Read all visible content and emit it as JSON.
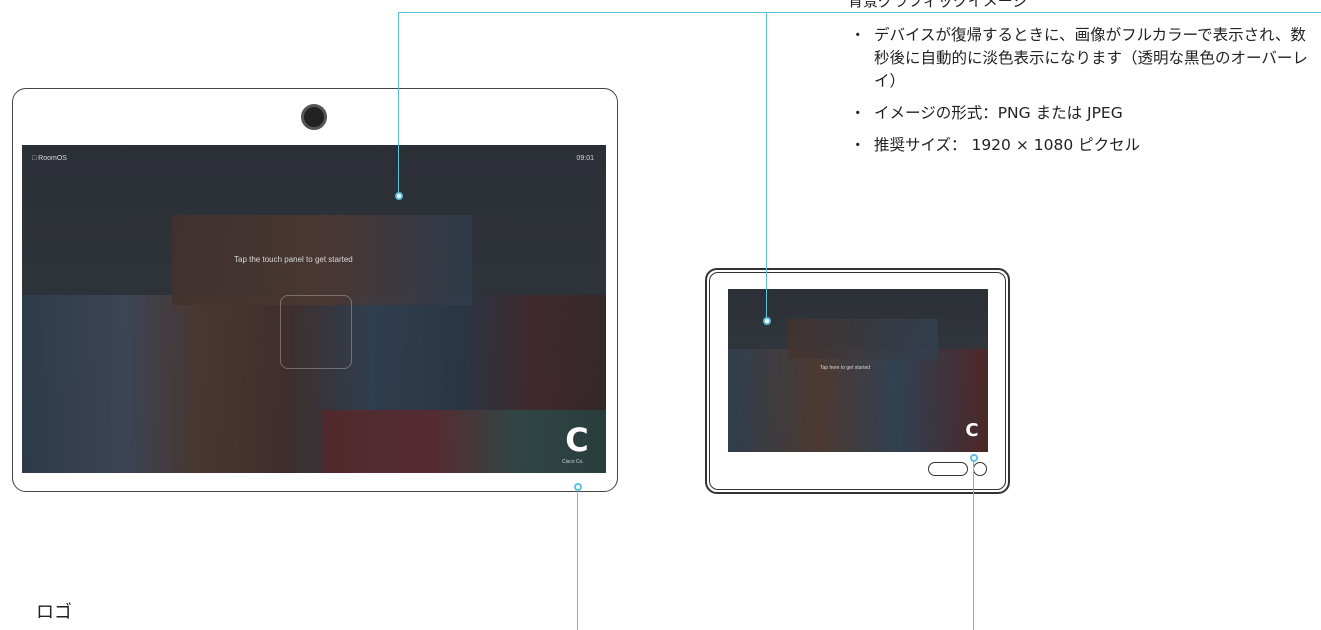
{
  "background_section": {
    "title": "背景グラフィックイメージ",
    "bullets": [
      "デバイスが復帰するときに、画像がフルカラーで表示され、数秒後に自動的に淡色表示になります（透明な黒色のオーバーレイ）",
      "イメージの形式：PNG または JPEG",
      "推奨サイズ： 1920 × 1080 ピクセル"
    ],
    "bullet_symbol": "・"
  },
  "logo_section": {
    "title": "ロゴ"
  },
  "big_display": {
    "status_left": "□  RoomOS",
    "status_right": "09:01",
    "prompt": "Tap the touch panel to get started",
    "logo_letter": "C",
    "logo_caption": "Cisco Co."
  },
  "small_display": {
    "prompt": "Tap here to get started",
    "logo_letter": "C"
  },
  "colors": {
    "callout": "#5cc0e0",
    "device_outline": "#333333"
  }
}
